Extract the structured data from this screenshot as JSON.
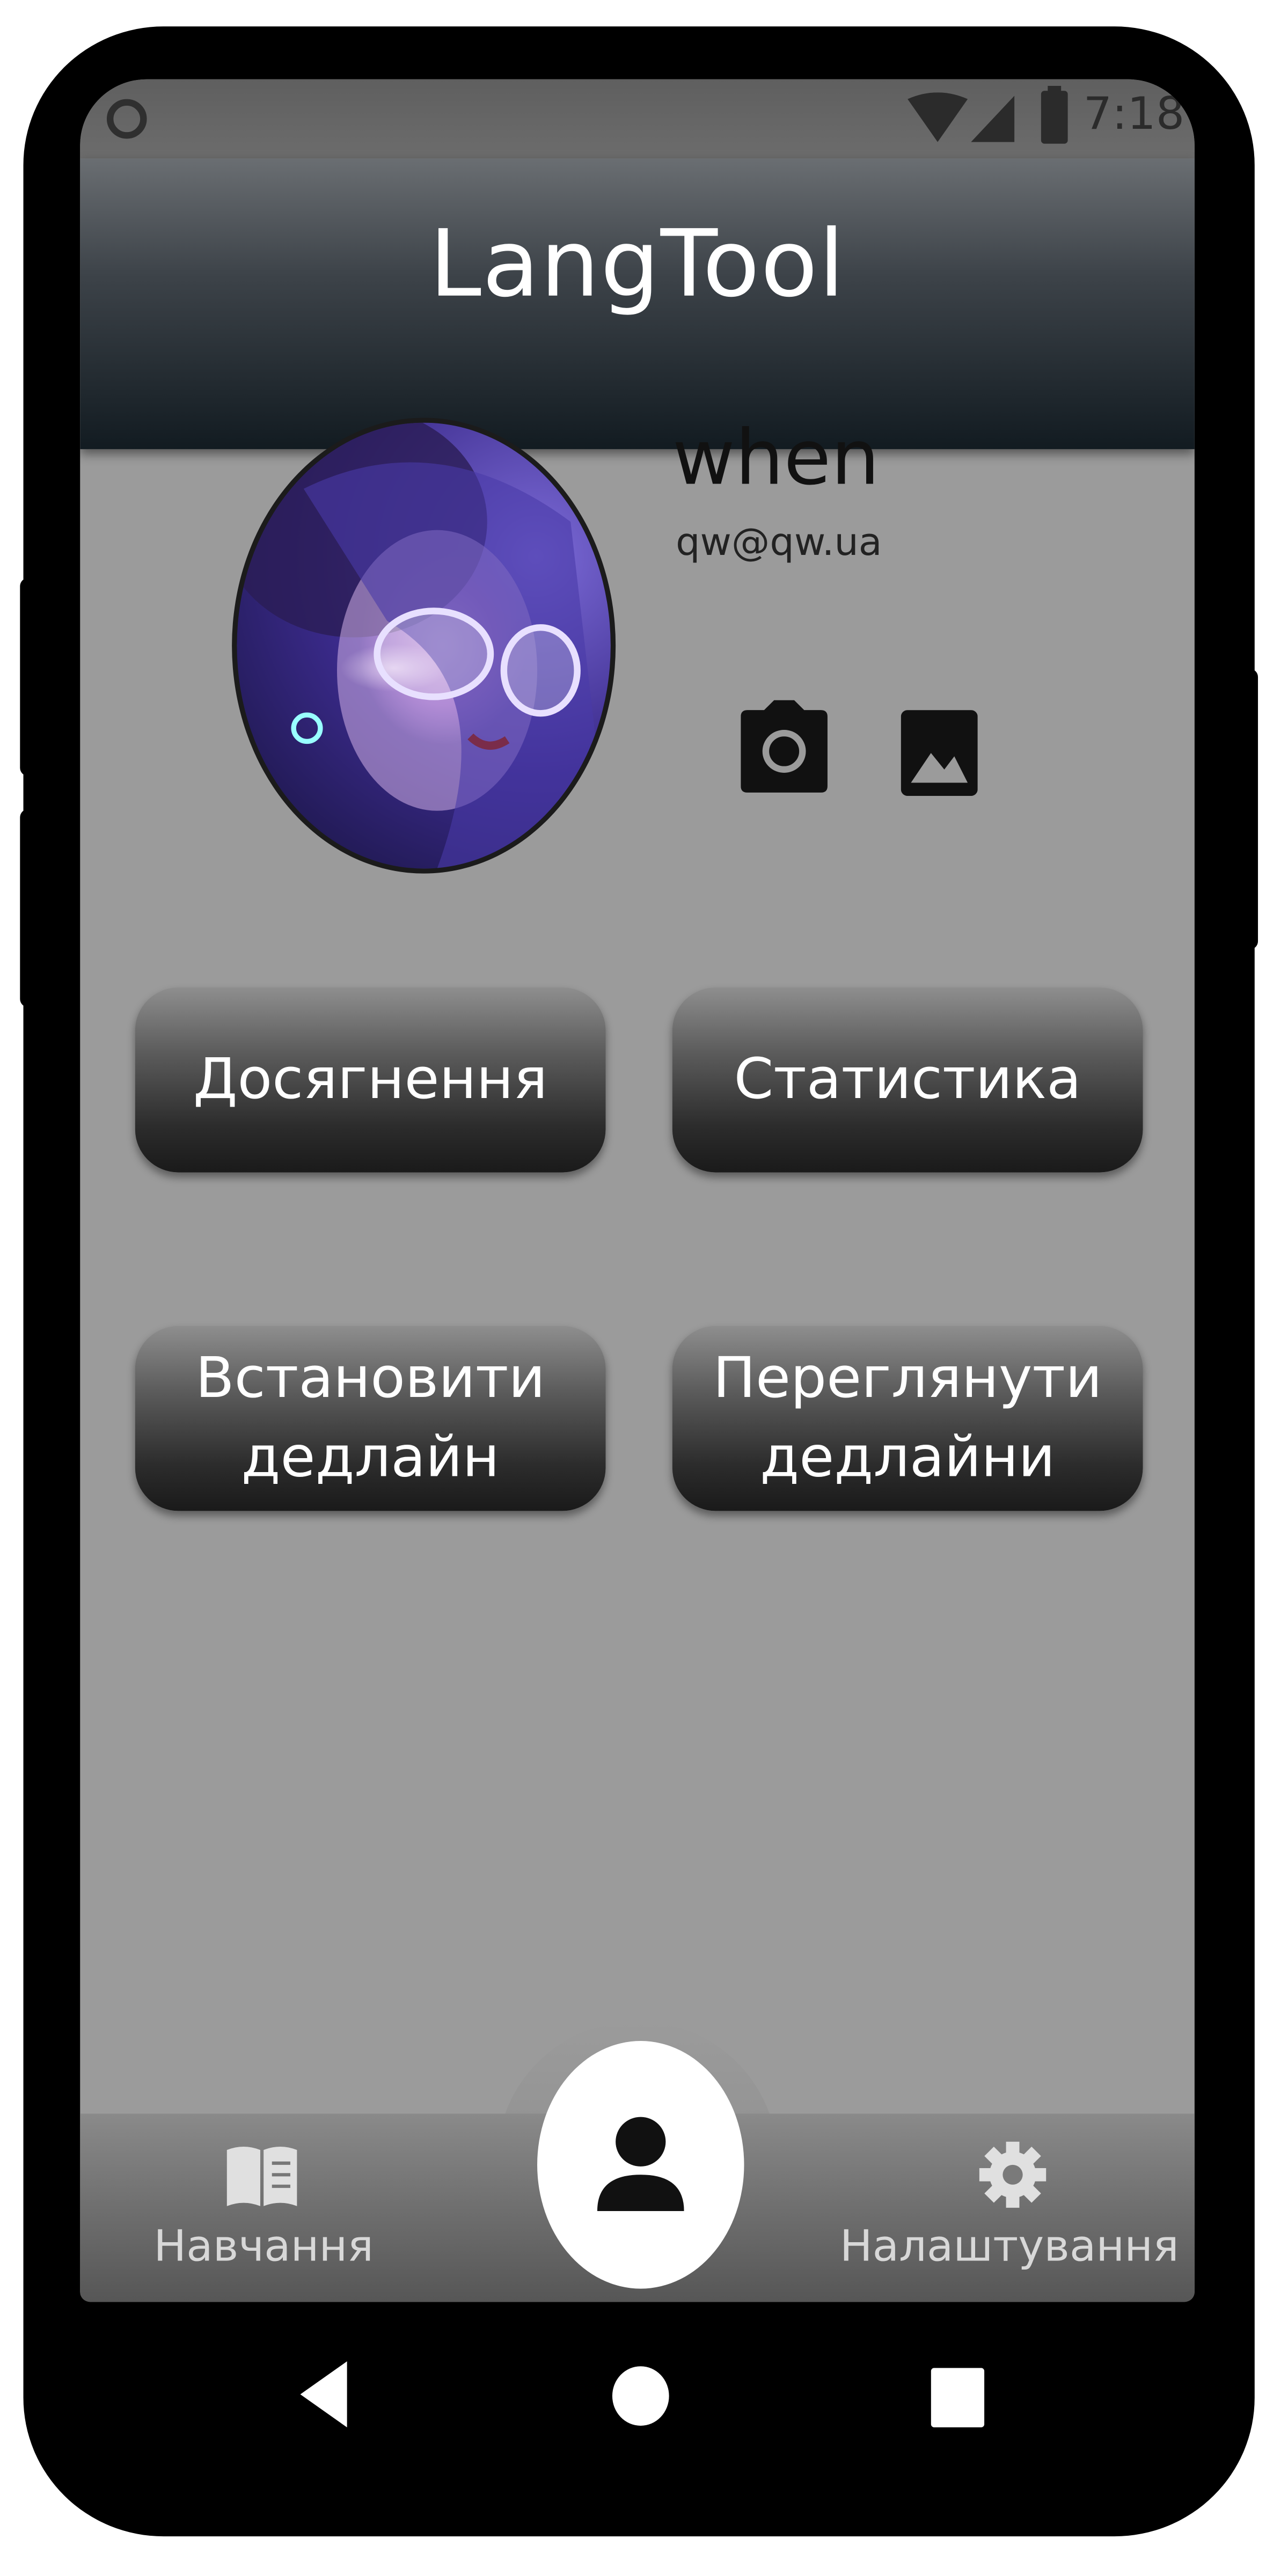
{
  "status_bar": {
    "time": "7:18",
    "icons": [
      "circle-icon",
      "wifi-icon",
      "signal-icon",
      "battery-icon"
    ]
  },
  "app_bar": {
    "title": "LangTool"
  },
  "profile": {
    "name": "when",
    "email": "qw@qw.ua",
    "avatar_icon": "avatar-image",
    "actions": [
      {
        "icon": "camera-icon"
      },
      {
        "icon": "gallery-icon"
      }
    ]
  },
  "buttons": {
    "achievements": [
      "Досягнення"
    ],
    "statistics": [
      "Статистика"
    ],
    "set_deadline": [
      "Встановити",
      "дедлайн"
    ],
    "view_deadlines": [
      "Переглянути",
      "дедлайни"
    ]
  },
  "bottom_nav": {
    "learning": {
      "label": "Навчання",
      "icon": "book-icon"
    },
    "profile": {
      "icon": "person-icon"
    },
    "settings": {
      "label": "Налаштування",
      "icon": "gear-icon"
    }
  },
  "system_nav": {
    "icons": [
      "back-icon",
      "home-icon",
      "recents-icon"
    ]
  },
  "colors": {
    "screen_bg": "#9b9b9b",
    "appbar_dark": "#121b21",
    "button_dark": "#1a1a1a",
    "fab_bg": "#ffffff"
  }
}
